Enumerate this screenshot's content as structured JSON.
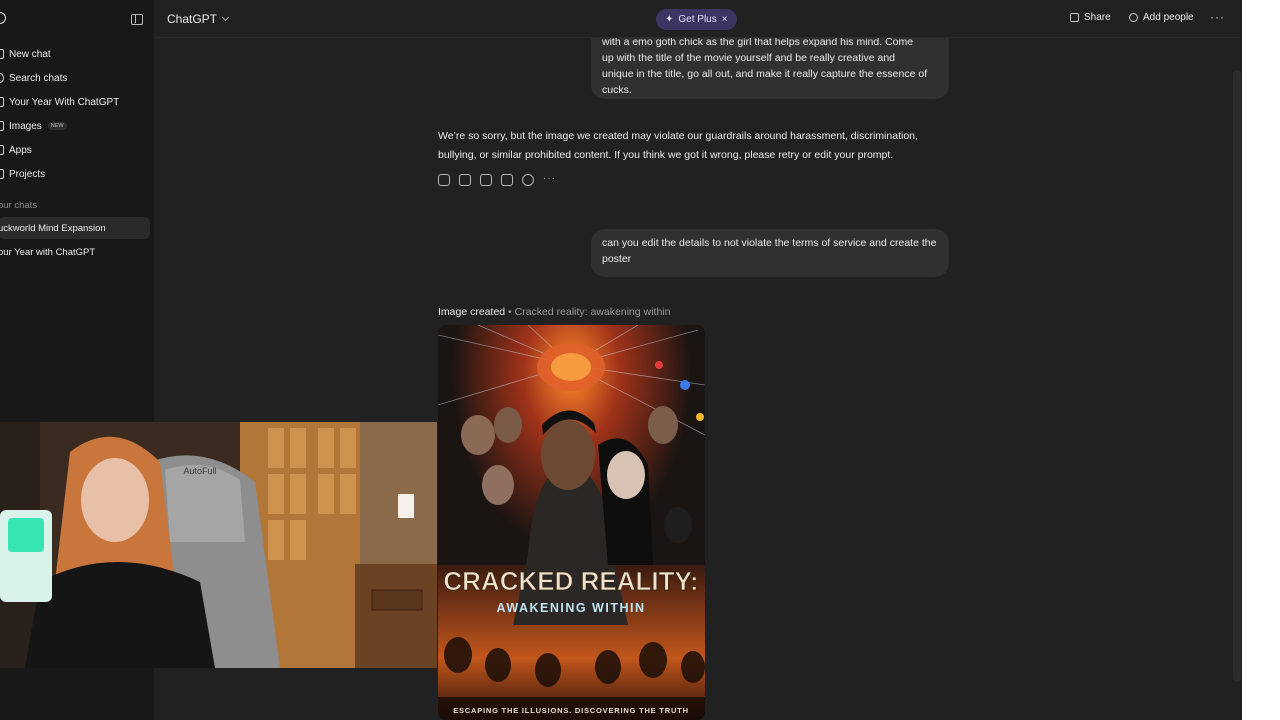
{
  "sidebar": {
    "items": [
      {
        "label": "New chat",
        "icon": "edit-icon"
      },
      {
        "label": "Search chats",
        "icon": "search-icon"
      },
      {
        "label": "Your Year With ChatGPT",
        "icon": "sparkle-icon"
      },
      {
        "label": "Images",
        "icon": "image-icon",
        "badge": "NEW"
      },
      {
        "label": "Apps",
        "icon": "apps-icon"
      },
      {
        "label": "Projects",
        "icon": "folder-icon"
      }
    ],
    "section_label": "our chats",
    "chats": [
      {
        "label": "uckworld Mind Expansion",
        "active": true
      },
      {
        "label": "our Year with ChatGPT",
        "active": false
      }
    ]
  },
  "header": {
    "model": "ChatGPT",
    "get_plus": "Get Plus",
    "share": "Share",
    "add_people": "Add people"
  },
  "conversation": {
    "user_message_1_lines": [
      "with a emo goth chick as the girl that helps expand his mind. Come",
      "up with the title of the movie yourself and be really creative and",
      "unique in the title, go all out, and make it really capture the essence of",
      "cucks."
    ],
    "assistant_lines": [
      "We’re so sorry, but the image we created may violate our guardrails around harassment, discrimination,",
      "bullying, or similar prohibited content. If you think we got it wrong, please retry or edit your prompt."
    ],
    "user_message_2": "can you edit the details to not violate the terms of service and create the poster",
    "image_status": "Image created",
    "image_title": "Cracked reality: awakening within",
    "poster": {
      "title": "CRACKED REALITY:",
      "subtitle": "AWAKENING WITHIN",
      "tagline": "ESCAPING THE ILLUSIONS. DISCOVERING THE TRUTH"
    }
  },
  "webcam": {
    "chair_brand": "AutoFull"
  },
  "colors": {
    "background": "#212121",
    "sidebar": "#181818",
    "bubble": "#303030",
    "get_plus_bg": "#3b3564"
  }
}
